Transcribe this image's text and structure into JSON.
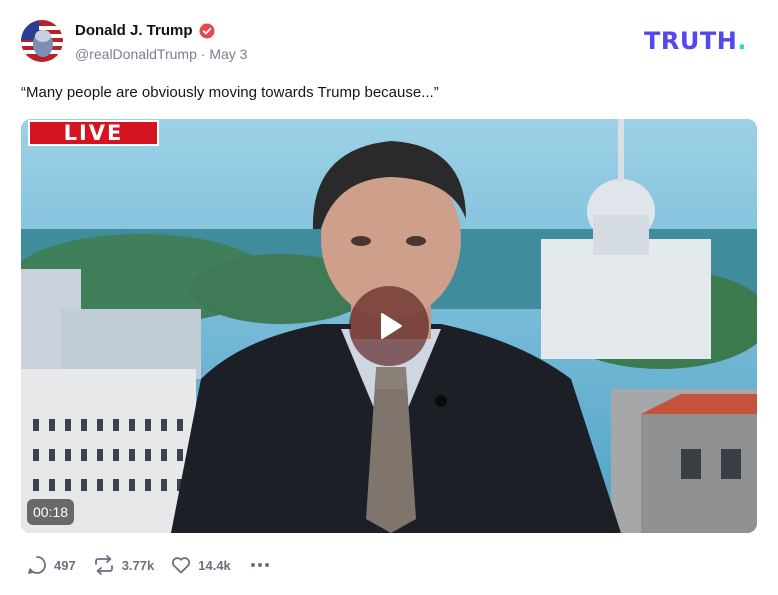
{
  "post": {
    "author_name": "Donald J. Trump",
    "handle": "@realDonaldTrump",
    "separator": "·",
    "date": "May 3",
    "text": "“Many people are obviously moving towards Trump because...”"
  },
  "brand": {
    "logo_text": "TRUTH",
    "logo_dot": ".",
    "logo_color": "#5448ee",
    "dot_color": "#18e0c9"
  },
  "video": {
    "live_label": "LIVE",
    "duration": "00:18"
  },
  "actions": {
    "replies": "497",
    "retruths": "3.77k",
    "likes": "14.4k"
  },
  "icons": [
    "verified-badge-icon",
    "play-icon",
    "reply-icon",
    "retruth-icon",
    "like-icon",
    "more-icon"
  ]
}
